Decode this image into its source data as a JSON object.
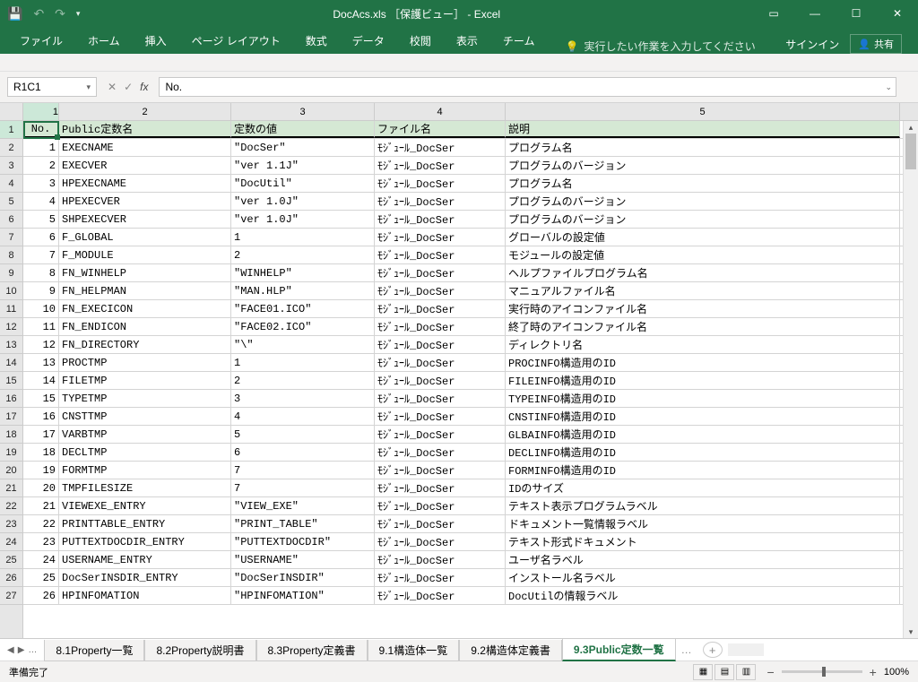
{
  "titlebar": {
    "title": "DocAcs.xls ［保護ビュー］ - Excel"
  },
  "ribbon": {
    "tabs": [
      "ファイル",
      "ホーム",
      "挿入",
      "ページ レイアウト",
      "数式",
      "データ",
      "校閲",
      "表示",
      "チーム"
    ],
    "search_placeholder": "実行したい作業を入力してください",
    "signin": "サインイン",
    "share": "共有"
  },
  "formula": {
    "namebox": "R1C1",
    "content": "No."
  },
  "columns": {
    "headers": [
      "1",
      "2",
      "3",
      "4",
      "5"
    ],
    "table_headers": [
      "No.",
      "Public定数名",
      "定数の値",
      "ファイル名",
      "説明"
    ]
  },
  "rows": [
    {
      "no": "1",
      "name": "EXECNAME",
      "val": "\"DocSer\"",
      "file": "ﾓｼﾞｭｰﾙ_DocSer",
      "desc": "プログラム名"
    },
    {
      "no": "2",
      "name": "EXECVER",
      "val": "\"ver 1.1J\"",
      "file": "ﾓｼﾞｭｰﾙ_DocSer",
      "desc": "プログラムのバージョン"
    },
    {
      "no": "3",
      "name": "HPEXECNAME",
      "val": "\"DocUtil\"",
      "file": "ﾓｼﾞｭｰﾙ_DocSer",
      "desc": "プログラム名"
    },
    {
      "no": "4",
      "name": "HPEXECVER",
      "val": "\"ver 1.0J\"",
      "file": "ﾓｼﾞｭｰﾙ_DocSer",
      "desc": "プログラムのバージョン"
    },
    {
      "no": "5",
      "name": "SHPEXECVER",
      "val": "\"ver 1.0J\"",
      "file": "ﾓｼﾞｭｰﾙ_DocSer",
      "desc": "プログラムのバージョン"
    },
    {
      "no": "6",
      "name": "F_GLOBAL",
      "val": "1",
      "file": "ﾓｼﾞｭｰﾙ_DocSer",
      "desc": "グローバルの設定値"
    },
    {
      "no": "7",
      "name": "F_MODULE",
      "val": "2",
      "file": "ﾓｼﾞｭｰﾙ_DocSer",
      "desc": "モジュールの設定値"
    },
    {
      "no": "8",
      "name": "FN_WINHELP",
      "val": "\"WINHELP\"",
      "file": "ﾓｼﾞｭｰﾙ_DocSer",
      "desc": "ヘルプファイルプログラム名"
    },
    {
      "no": "9",
      "name": "FN_HELPMAN",
      "val": "\"MAN.HLP\"",
      "file": "ﾓｼﾞｭｰﾙ_DocSer",
      "desc": "マニュアルファイル名"
    },
    {
      "no": "10",
      "name": "FN_EXECICON",
      "val": "\"FACE01.ICO\"",
      "file": "ﾓｼﾞｭｰﾙ_DocSer",
      "desc": "実行時のアイコンファイル名"
    },
    {
      "no": "11",
      "name": "FN_ENDICON",
      "val": "\"FACE02.ICO\"",
      "file": "ﾓｼﾞｭｰﾙ_DocSer",
      "desc": "終了時のアイコンファイル名"
    },
    {
      "no": "12",
      "name": "FN_DIRECTORY",
      "val": "\"\\\"",
      "file": "ﾓｼﾞｭｰﾙ_DocSer",
      "desc": "ディレクトリ名"
    },
    {
      "no": "13",
      "name": "PROCTMP",
      "val": "1",
      "file": "ﾓｼﾞｭｰﾙ_DocSer",
      "desc": "PROCINFO構造用のID"
    },
    {
      "no": "14",
      "name": "FILETMP",
      "val": "2",
      "file": "ﾓｼﾞｭｰﾙ_DocSer",
      "desc": "FILEINFO構造用のID"
    },
    {
      "no": "15",
      "name": "TYPETMP",
      "val": "3",
      "file": "ﾓｼﾞｭｰﾙ_DocSer",
      "desc": "TYPEINFO構造用のID"
    },
    {
      "no": "16",
      "name": "CNSTTMP",
      "val": "4",
      "file": "ﾓｼﾞｭｰﾙ_DocSer",
      "desc": "CNSTINFO構造用のID"
    },
    {
      "no": "17",
      "name": "VARBTMP",
      "val": "5",
      "file": "ﾓｼﾞｭｰﾙ_DocSer",
      "desc": "GLBAINFO構造用のID"
    },
    {
      "no": "18",
      "name": "DECLTMP",
      "val": "6",
      "file": "ﾓｼﾞｭｰﾙ_DocSer",
      "desc": "DECLINFO構造用のID"
    },
    {
      "no": "19",
      "name": "FORMTMP",
      "val": "7",
      "file": "ﾓｼﾞｭｰﾙ_DocSer",
      "desc": "FORMINFO構造用のID"
    },
    {
      "no": "20",
      "name": "TMPFILESIZE",
      "val": "7",
      "file": "ﾓｼﾞｭｰﾙ_DocSer",
      "desc": "IDのサイズ"
    },
    {
      "no": "21",
      "name": "VIEWEXE_ENTRY",
      "val": "\"VIEW_EXE\"",
      "file": "ﾓｼﾞｭｰﾙ_DocSer",
      "desc": "テキスト表示プログラムラベル"
    },
    {
      "no": "22",
      "name": "PRINTTABLE_ENTRY",
      "val": "\"PRINT_TABLE\"",
      "file": "ﾓｼﾞｭｰﾙ_DocSer",
      "desc": "ドキュメント一覧情報ラベル"
    },
    {
      "no": "23",
      "name": "PUTTEXTDOCDIR_ENTRY",
      "val": "\"PUTTEXTDOCDIR\"",
      "file": "ﾓｼﾞｭｰﾙ_DocSer",
      "desc": "テキスト形式ドキュメント"
    },
    {
      "no": "24",
      "name": "USERNAME_ENTRY",
      "val": "\"USERNAME\"",
      "file": "ﾓｼﾞｭｰﾙ_DocSer",
      "desc": "ユーザ名ラベル"
    },
    {
      "no": "25",
      "name": "DocSerINSDIR_ENTRY",
      "val": "\"DocSerINSDIR\"",
      "file": "ﾓｼﾞｭｰﾙ_DocSer",
      "desc": "インストール名ラベル"
    },
    {
      "no": "26",
      "name": "HPINFOMATION",
      "val": "\"HPINFOMATION\"",
      "file": "ﾓｼﾞｭｰﾙ_DocSer",
      "desc": "DocUtilの情報ラベル"
    }
  ],
  "sheets": {
    "tabs": [
      "8.1Property一覧",
      "8.2Property説明書",
      "8.3Property定義書",
      "9.1構造体一覧",
      "9.2構造体定義書",
      "9.3Public定数一覧"
    ],
    "active_index": 5
  },
  "status": {
    "ready": "準備完了",
    "zoom": "100%"
  }
}
